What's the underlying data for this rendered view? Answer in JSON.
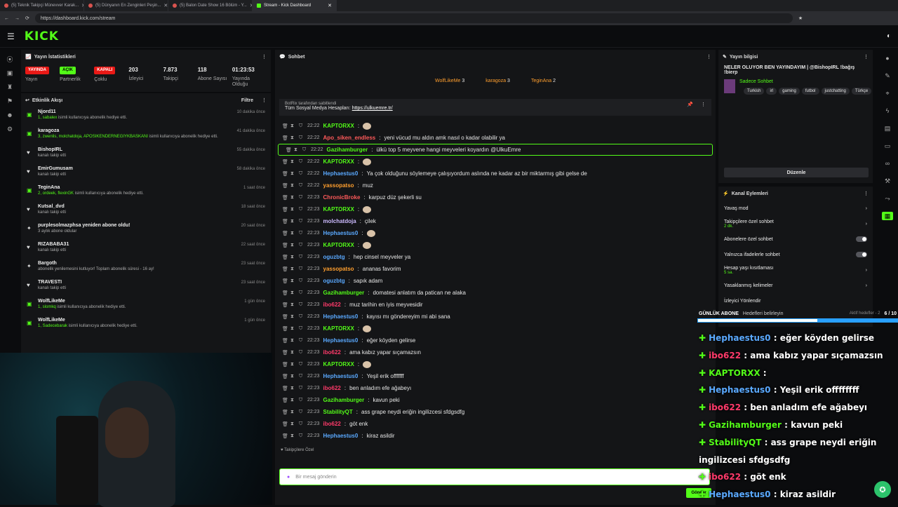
{
  "browser": {
    "tabs": [
      {
        "label": "(5) Teknik Takipçi Münevver Karak...",
        "active": false
      },
      {
        "label": "(5) Dünyanın En Zenginleri Peşin...",
        "active": false
      },
      {
        "label": "(5) Balon Date Show 16 Bölüm - Y...",
        "active": false
      },
      {
        "label": "Stream - Kick Dashboard",
        "active": true
      }
    ],
    "url": "https://dashboard.kick.com/stream"
  },
  "brand": {
    "logo": "KICK",
    "accent": "#53fc18"
  },
  "stats": {
    "title": "Yayın İstatistikleri",
    "items": [
      {
        "badge": "YAYINDA",
        "label": "Yayın"
      },
      {
        "badge": "AÇIK",
        "label": "Partnerlik"
      },
      {
        "badge": "KAPALI",
        "label": "Çoklu"
      },
      {
        "value": "203",
        "label": "İzleyici"
      },
      {
        "value": "7.873",
        "label": "Takipçi"
      },
      {
        "value": "118",
        "label": "Abone Sayısı"
      },
      {
        "value": "01:23:53",
        "label": "Yayında Olduğu"
      }
    ]
  },
  "activity": {
    "title": "Etkinlik Akışı",
    "filter": "Filtre",
    "items": [
      {
        "name": "Njord11",
        "sub_names": "1, sabalex",
        "sub_text": "isimli kullanıcıya abonelik hediye etti.",
        "time": "10 dakika önce",
        "icon": "gift"
      },
      {
        "name": "karagoza",
        "sub_names": "3, zwenlis, molchatdoja, APOSIKENDERNEGIYKBASKANI",
        "sub_text": "isimli kullanıcıya abonelik hediye etti.",
        "time": "41 dakika önce",
        "icon": "gift"
      },
      {
        "name": "BishopIRL",
        "sub_names": "",
        "sub_text": "kanalı takip etti",
        "time": "55 dakika önce",
        "icon": "heart"
      },
      {
        "name": "EmirGumusam",
        "sub_names": "",
        "sub_text": "kanalı takip etti",
        "time": "58 dakika önce",
        "icon": "heart"
      },
      {
        "name": "TeginAna",
        "sub_names": "2, ordeek, flexinGK",
        "sub_text": "isimli kullanıcıya abonelik hediye etti.",
        "time": "1 saat önce",
        "icon": "gift"
      },
      {
        "name": "Kutsal_dvd",
        "sub_names": "",
        "sub_text": "kanalı takip etti",
        "time": "18 saat önce",
        "icon": "heart"
      },
      {
        "name": "purplesolmazphsa yeniden abone oldu!",
        "sub_names": "",
        "sub_text": "3 aylık abone oldular",
        "time": "20 saat önce",
        "icon": "star"
      },
      {
        "name": "RIZABABA31",
        "sub_names": "",
        "sub_text": "kanalı takip etti",
        "time": "22 saat önce",
        "icon": "heart"
      },
      {
        "name": "Bargoth",
        "sub_names": "",
        "sub_text": "abonelik yenilemesini kutluyor! Toplam abonelik süresi - 16 ay!",
        "time": "23 saat önce",
        "icon": "star"
      },
      {
        "name": "TRAVESTI",
        "sub_names": "",
        "sub_text": "kanalı takip etti",
        "time": "23 saat önce",
        "icon": "heart"
      },
      {
        "name": "WolfLikeMe",
        "sub_names": "1, slomkq",
        "sub_text": "isimli kullanıcıya abonelik hediye etti.",
        "time": "1 gün önce",
        "icon": "gift"
      },
      {
        "name": "WolfLikeMe",
        "sub_names": "1, Sadecebarak",
        "sub_text": "isimli kullanıcıya abonelik hediye etti.",
        "time": "1 gün önce",
        "icon": "gift"
      }
    ]
  },
  "chat": {
    "title": "Sohbet",
    "top_gifters": [
      {
        "name": "WolfLikeMe",
        "count": "3"
      },
      {
        "name": "karagoza",
        "count": "3"
      },
      {
        "name": "TeginAna",
        "count": "2"
      }
    ],
    "pinned": {
      "by": "BotRix tarafından sabitlendi",
      "text": "Tüm Sosyal Medya Hesapları:",
      "link": "https://ulkuemre.tr/"
    },
    "messages": [
      {
        "time": "22:22",
        "user": "KAPTORXX",
        "color": "#53fc18",
        "text": "",
        "emote": true
      },
      {
        "time": "22:22",
        "user": "Apo_siken_endless",
        "color": "#ff5a5a",
        "text": "yeni vücud mu aldın amk nasıl o kadar olabilir ya"
      },
      {
        "time": "22:22",
        "user": "Gazihamburger",
        "color": "#53fc18",
        "text": "ülkü top 5 meyvene hangi meyveleri koyardın @UlkuEmre",
        "highlight": true
      },
      {
        "time": "22:22",
        "user": "KAPTORXX",
        "color": "#53fc18",
        "text": "",
        "emote": true
      },
      {
        "time": "22:22",
        "user": "Hephaestus0",
        "color": "#5aa9ff",
        "text": "Ya çok olduğunu söylemeye çalışıyordum aslında ne kadar az bir miktarmış gibi gelse de"
      },
      {
        "time": "22:22",
        "user": "yassopatso",
        "color": "#ff9f2e",
        "text": "muz"
      },
      {
        "time": "22:23",
        "user": "ChronicBroke",
        "color": "#ff5a5a",
        "text": "karpuz düz şekerli su"
      },
      {
        "time": "22:23",
        "user": "KAPTORXX",
        "color": "#53fc18",
        "text": "",
        "emote": true
      },
      {
        "time": "22:23",
        "user": "molchatdoja",
        "color": "#cdbbff",
        "text": "çilek"
      },
      {
        "time": "22:23",
        "user": "Hephaestus0",
        "color": "#5aa9ff",
        "text": "",
        "emote": true
      },
      {
        "time": "22:23",
        "user": "KAPTORXX",
        "color": "#53fc18",
        "text": "",
        "emote": true
      },
      {
        "time": "22:23",
        "user": "oguzbtg",
        "color": "#5aa9ff",
        "text": "hep cinsel meyveler ya"
      },
      {
        "time": "22:23",
        "user": "yassopatso",
        "color": "#ff9f2e",
        "text": "ananas favorim"
      },
      {
        "time": "22:23",
        "user": "oguzbtg",
        "color": "#5aa9ff",
        "text": "sapık adam"
      },
      {
        "time": "22:23",
        "user": "Gazihamburger",
        "color": "#53fc18",
        "text": "domatesi anlatım da patican ne alaka"
      },
      {
        "time": "22:23",
        "user": "ibo622",
        "color": "#ff3a6a",
        "text": "muz tarihin en iyis meyvesidir"
      },
      {
        "time": "22:23",
        "user": "Hephaestus0",
        "color": "#5aa9ff",
        "text": "kayısı mı göndereyim mi abi sana"
      },
      {
        "time": "22:23",
        "user": "KAPTORXX",
        "color": "#53fc18",
        "text": "",
        "emote": true
      },
      {
        "time": "22:23",
        "user": "Hephaestus0",
        "color": "#5aa9ff",
        "text": "eğer köyden gelirse"
      },
      {
        "time": "22:23",
        "user": "ibo622",
        "color": "#ff3a6a",
        "text": "ama kabız yapar sıçamazsın"
      },
      {
        "time": "22:23",
        "user": "KAPTORXX",
        "color": "#53fc18",
        "text": "",
        "emote": true
      },
      {
        "time": "22:23",
        "user": "Hephaestus0",
        "color": "#5aa9ff",
        "text": "Yeşil erik offfffff"
      },
      {
        "time": "22:23",
        "user": "ibo622",
        "color": "#ff3a6a",
        "text": "ben anladım efe ağabeyı"
      },
      {
        "time": "22:23",
        "user": "Gazihamburger",
        "color": "#53fc18",
        "text": "kavun peki"
      },
      {
        "time": "22:23",
        "user": "StabilityQT",
        "color": "#53fc18",
        "text": "ass grape neydi eriğin ingilizcesi sfdgsdfg"
      },
      {
        "time": "22:23",
        "user": "ibo622",
        "color": "#ff3a6a",
        "text": "göt enk"
      },
      {
        "time": "22:23",
        "user": "Hephaestus0",
        "color": "#5aa9ff",
        "text": "kiraz asildir"
      }
    ],
    "followers_only": "Takipçilere Özel",
    "input_placeholder": "Bir mesaj gönderin",
    "send_label": "Gönder"
  },
  "stream_info": {
    "title": "Yayın bilgisi",
    "stream_title": "NELER OLUYOR BEN YAYINDAYIM | @BishopIRL !bağış !bierp",
    "category": "Sadece Sohbet",
    "tags": [
      "Turkish",
      "irl",
      "gaming",
      "futbol",
      "justchatting",
      "Türkçe"
    ],
    "edit": "Düzenle"
  },
  "channel_actions": {
    "title": "Kanal Eylemleri",
    "rows": [
      {
        "label": "Yavaş mod",
        "type": "chev"
      },
      {
        "label": "Takipçilere özel sohbet",
        "sub": "2 dk.",
        "type": "chev"
      },
      {
        "label": "Abonelere özel sohbet",
        "type": "toggle"
      },
      {
        "label": "Yalnızca ifadelerle sohbet",
        "type": "toggle"
      },
      {
        "label": "Hesap yaşı kısıtlaması",
        "sub": "5 sa.",
        "type": "chev"
      },
      {
        "label": "Yasaklanmış kelimeler",
        "type": "chev"
      },
      {
        "label": "İzleyici Yönlendir",
        "type": "none"
      }
    ]
  },
  "overlay": {
    "goal_label": "GÜNLÜK ABONE",
    "goal_sub": "Aktif hedefler - 2",
    "goal_count": "6 / 10",
    "behind": "Hedefleri belirleyin",
    "lines": [
      {
        "user": "Hephaestus0",
        "text": "eğer köyden gelirse",
        "color": "#5aa9ff"
      },
      {
        "user": "ibo622",
        "text": "ama kabız yapar sıçamazsın",
        "color": "#ff3a6a"
      },
      {
        "user": "KAPTORXX",
        "text": "",
        "color": "#53fc18"
      },
      {
        "user": "Hephaestus0",
        "text": "Yeşil erik offffffff",
        "color": "#5aa9ff"
      },
      {
        "user": "ibo622",
        "text": "ben anladım efe ağabeyı",
        "color": "#ff3a6a"
      },
      {
        "user": "Gazihamburger",
        "text": "kavun peki",
        "color": "#53fc18"
      },
      {
        "user": "StabilityQT",
        "text": "ass grape neydi eriğin",
        "color": "#53fc18"
      },
      {
        "user": "",
        "text": "ingilizcesi sfdgsdfg",
        "color": "#fff"
      },
      {
        "user": "ibo622",
        "text": "göt enk",
        "color": "#ff3a6a"
      },
      {
        "user": "Hephaestus0",
        "text": "kiraz asildir",
        "color": "#5aa9ff"
      }
    ]
  }
}
